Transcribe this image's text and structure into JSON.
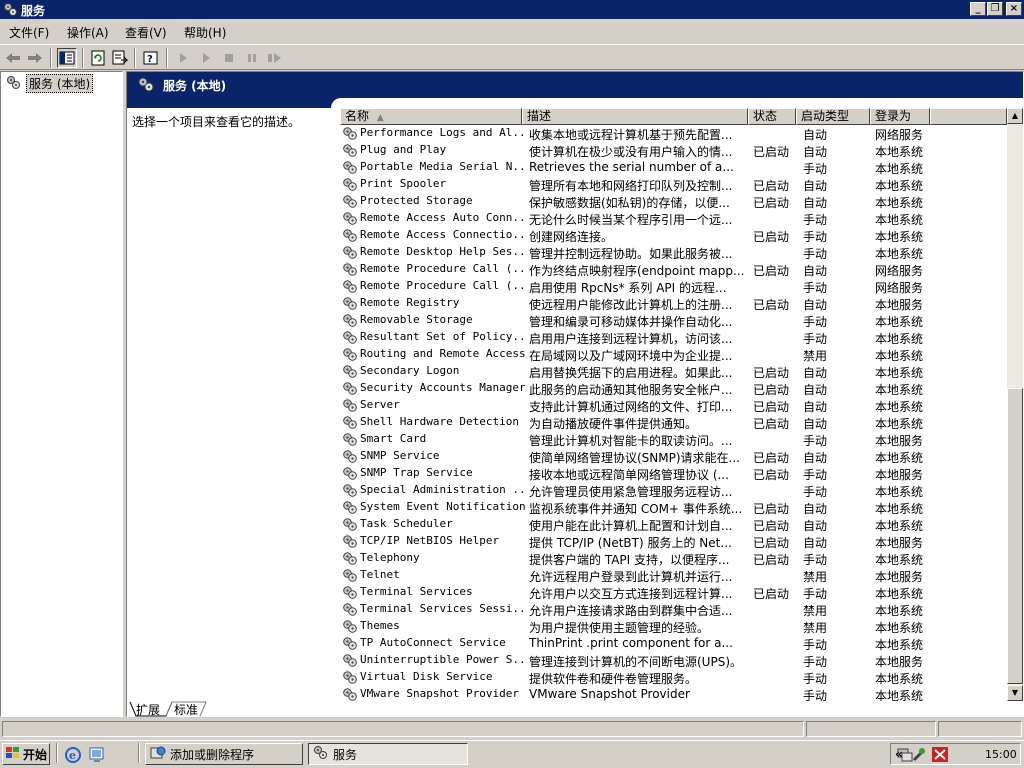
{
  "window": {
    "title": "服务"
  },
  "caption_buttons": {
    "minimize": "_",
    "maximize": "❐",
    "close": "×"
  },
  "menu": [
    "文件(F)",
    "操作(A)",
    "查看(V)",
    "帮助(H)"
  ],
  "tree": {
    "root_label": "服务 (本地)"
  },
  "panel": {
    "header_title": "服务 (本地)",
    "description_hint": "选择一个项目来查看它的描述。"
  },
  "columns": {
    "name": "名称",
    "description": "描述",
    "status": "状态",
    "startup_type": "启动类型",
    "logon_as": "登录为"
  },
  "services": [
    [
      "Performance Logs and Al...",
      "收集本地或远程计算机基于预先配置...",
      "",
      "自动",
      "网络服务"
    ],
    [
      "Plug and Play",
      "使计算机在极少或没有用户输入的情...",
      "已启动",
      "自动",
      "本地系统"
    ],
    [
      "Portable Media Serial N...",
      "Retrieves the serial number of a...",
      "",
      "手动",
      "本地系统"
    ],
    [
      "Print Spooler",
      "管理所有本地和网络打印队列及控制...",
      "已启动",
      "自动",
      "本地系统"
    ],
    [
      "Protected Storage",
      "保护敏感数据(如私钥)的存储，以便...",
      "已启动",
      "自动",
      "本地系统"
    ],
    [
      "Remote Access Auto Conn...",
      "无论什么时候当某个程序引用一个远...",
      "",
      "手动",
      "本地系统"
    ],
    [
      "Remote Access Connectio...",
      "创建网络连接。",
      "已启动",
      "手动",
      "本地系统"
    ],
    [
      "Remote Desktop Help Ses...",
      "管理并控制远程协助。如果此服务被...",
      "",
      "手动",
      "本地系统"
    ],
    [
      "Remote Procedure Call (...",
      "作为终结点映射程序(endpoint mapp...",
      "已启动",
      "自动",
      "网络服务"
    ],
    [
      "Remote Procedure Call (...",
      "启用使用 RpcNs* 系列 API 的远程...",
      "",
      "手动",
      "网络服务"
    ],
    [
      "Remote Registry",
      "使远程用户能修改此计算机上的注册...",
      "已启动",
      "自动",
      "本地服务"
    ],
    [
      "Removable Storage",
      "管理和编录可移动媒体并操作自动化...",
      "",
      "手动",
      "本地系统"
    ],
    [
      "Resultant Set of Policy...",
      "启用用户连接到远程计算机，访问该...",
      "",
      "手动",
      "本地系统"
    ],
    [
      "Routing and Remote Access",
      "在局域网以及广域网环境中为企业提...",
      "",
      "禁用",
      "本地系统"
    ],
    [
      "Secondary Logon",
      "启用替换凭据下的启用进程。如果此...",
      "已启动",
      "自动",
      "本地系统"
    ],
    [
      "Security Accounts Manager",
      "此服务的启动通知其他服务安全帐户...",
      "已启动",
      "自动",
      "本地系统"
    ],
    [
      "Server",
      "支持此计算机通过网络的文件、打印...",
      "已启动",
      "自动",
      "本地系统"
    ],
    [
      "Shell Hardware Detection",
      "为自动播放硬件事件提供通知。",
      "已启动",
      "自动",
      "本地系统"
    ],
    [
      "Smart Card",
      "管理此计算机对智能卡的取读访问。...",
      "",
      "手动",
      "本地服务"
    ],
    [
      "SNMP Service",
      "使简单网络管理协议(SNMP)请求能在...",
      "已启动",
      "自动",
      "本地系统"
    ],
    [
      "SNMP Trap Service",
      "接收本地或远程简单网络管理协议 (...",
      "已启动",
      "手动",
      "本地服务"
    ],
    [
      "Special Administration ...",
      "允许管理员使用紧急管理服务远程访...",
      "",
      "手动",
      "本地系统"
    ],
    [
      "System Event Notification",
      "监视系统事件并通知 COM+ 事件系统...",
      "已启动",
      "自动",
      "本地系统"
    ],
    [
      "Task Scheduler",
      "使用户能在此计算机上配置和计划自...",
      "已启动",
      "自动",
      "本地系统"
    ],
    [
      "TCP/IP NetBIOS Helper",
      "提供 TCP/IP (NetBT) 服务上的 Net...",
      "已启动",
      "自动",
      "本地服务"
    ],
    [
      "Telephony",
      "提供客户端的 TAPI 支持，以便程序...",
      "已启动",
      "手动",
      "本地系统"
    ],
    [
      "Telnet",
      "允许远程用户登录到此计算机并运行...",
      "",
      "禁用",
      "本地服务"
    ],
    [
      "Terminal Services",
      "允许用户以交互方式连接到远程计算...",
      "已启动",
      "手动",
      "本地系统"
    ],
    [
      "Terminal Services Sessi...",
      "允许用户连接请求路由到群集中合适...",
      "",
      "禁用",
      "本地系统"
    ],
    [
      "Themes",
      "为用户提供使用主题管理的经验。",
      "",
      "禁用",
      "本地系统"
    ],
    [
      "TP AutoConnect Service",
      "ThinPrint .print component for a...",
      "",
      "手动",
      "本地系统"
    ],
    [
      "Uninterruptible Power S...",
      "管理连接到计算机的不间断电源(UPS)。",
      "",
      "手动",
      "本地服务"
    ],
    [
      "Virtual Disk Service",
      "提供软件卷和硬件卷管理服务。",
      "",
      "手动",
      "本地系统"
    ],
    [
      "VMware Snapshot Provider",
      "VMware Snapshot Provider",
      "",
      "手动",
      "本地系统"
    ]
  ],
  "tabs": [
    "扩展",
    "标准"
  ],
  "taskbar": {
    "start_label": "开始",
    "tasks": [
      "添加或删除程序",
      "服务"
    ],
    "tray_expand": "«",
    "clock": "15:00"
  },
  "colors": {
    "titlebar": "#0a246a",
    "face": "#d4d0c8",
    "window_bg": "#ffffff"
  },
  "icons": [
    "services-gear-icon",
    "back-arrow-icon",
    "forward-arrow-icon",
    "console-tree-icon",
    "refresh-icon",
    "export-list-icon",
    "help-icon",
    "play-icon",
    "stop-icon",
    "pause-icon",
    "restart-icon",
    "ie-icon",
    "desktop-icon"
  ]
}
